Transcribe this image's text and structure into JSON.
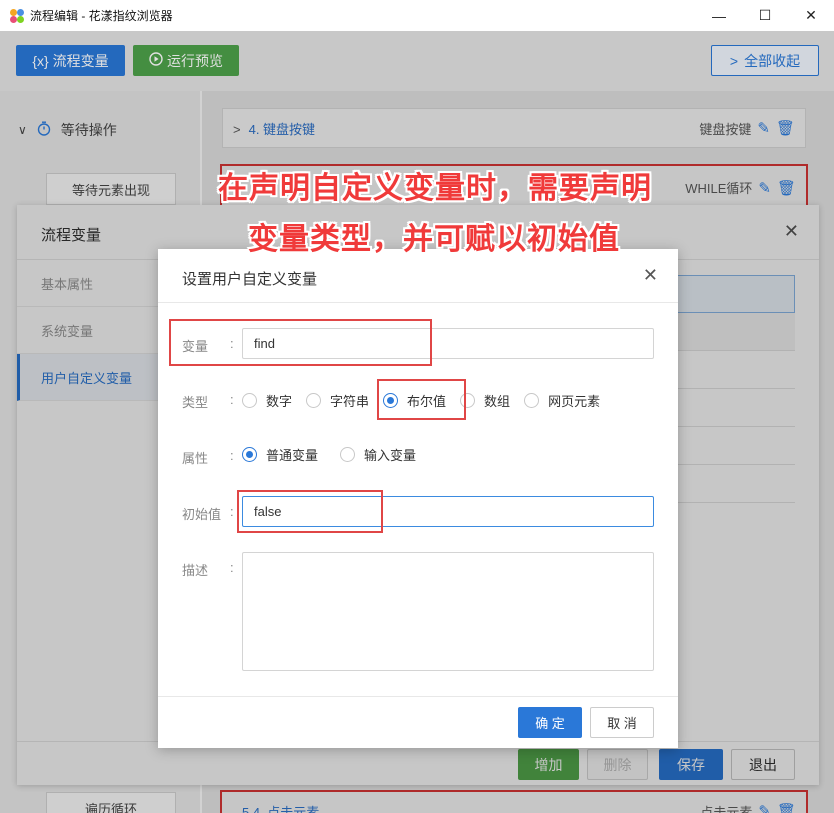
{
  "window": {
    "title": "流程编辑 - 花漾指纹浏览器",
    "minimize": "—",
    "maximize": "☐",
    "close": "✕"
  },
  "toolbar": {
    "flow_vars_label": "流程变量",
    "flow_vars_icon": "{x}",
    "run_preview_label": "运行预览",
    "collapse_all_label": "全部收起"
  },
  "left_panel": {
    "wait_op_label": "等待操作",
    "wait_appear_label": "等待元素出现",
    "traverse_label": "遍历循环"
  },
  "steps": {
    "step4_title": "4. 键盘按键",
    "step4_type": "键盘按键",
    "while_type": "WHILE循环",
    "bottom_title": "5.4. 点击元素",
    "bottom_type": "点击元素"
  },
  "caption": {
    "line1": "在声明自定义变量时，需要声明",
    "line2": "变量类型，并可赋以初始值"
  },
  "flow_vars_dialog": {
    "title": "流程变量",
    "nav": [
      "基本属性",
      "系统变量",
      "用户自定义变量"
    ],
    "add_label": "增加",
    "delete_label": "删除",
    "save_label": "保存",
    "exit_label": "退出"
  },
  "user_var_dialog": {
    "title": "设置用户自定义变量",
    "variable_label": "变量",
    "variable_value": "find",
    "type_label": "类型",
    "type_options": [
      "数字",
      "字符串",
      "布尔值",
      "数组",
      "网页元素"
    ],
    "type_selected": "布尔值",
    "attr_label": "属性",
    "attr_options": [
      "普通变量",
      "输入变量"
    ],
    "attr_selected": "普通变量",
    "initial_label": "初始值",
    "initial_value": "false",
    "desc_label": "描述",
    "ok_label": "确 定",
    "cancel_label": "取 消"
  },
  "colors": {
    "primary": "#2a78d8",
    "success": "#4ea24a",
    "annotation": "#e04646"
  }
}
